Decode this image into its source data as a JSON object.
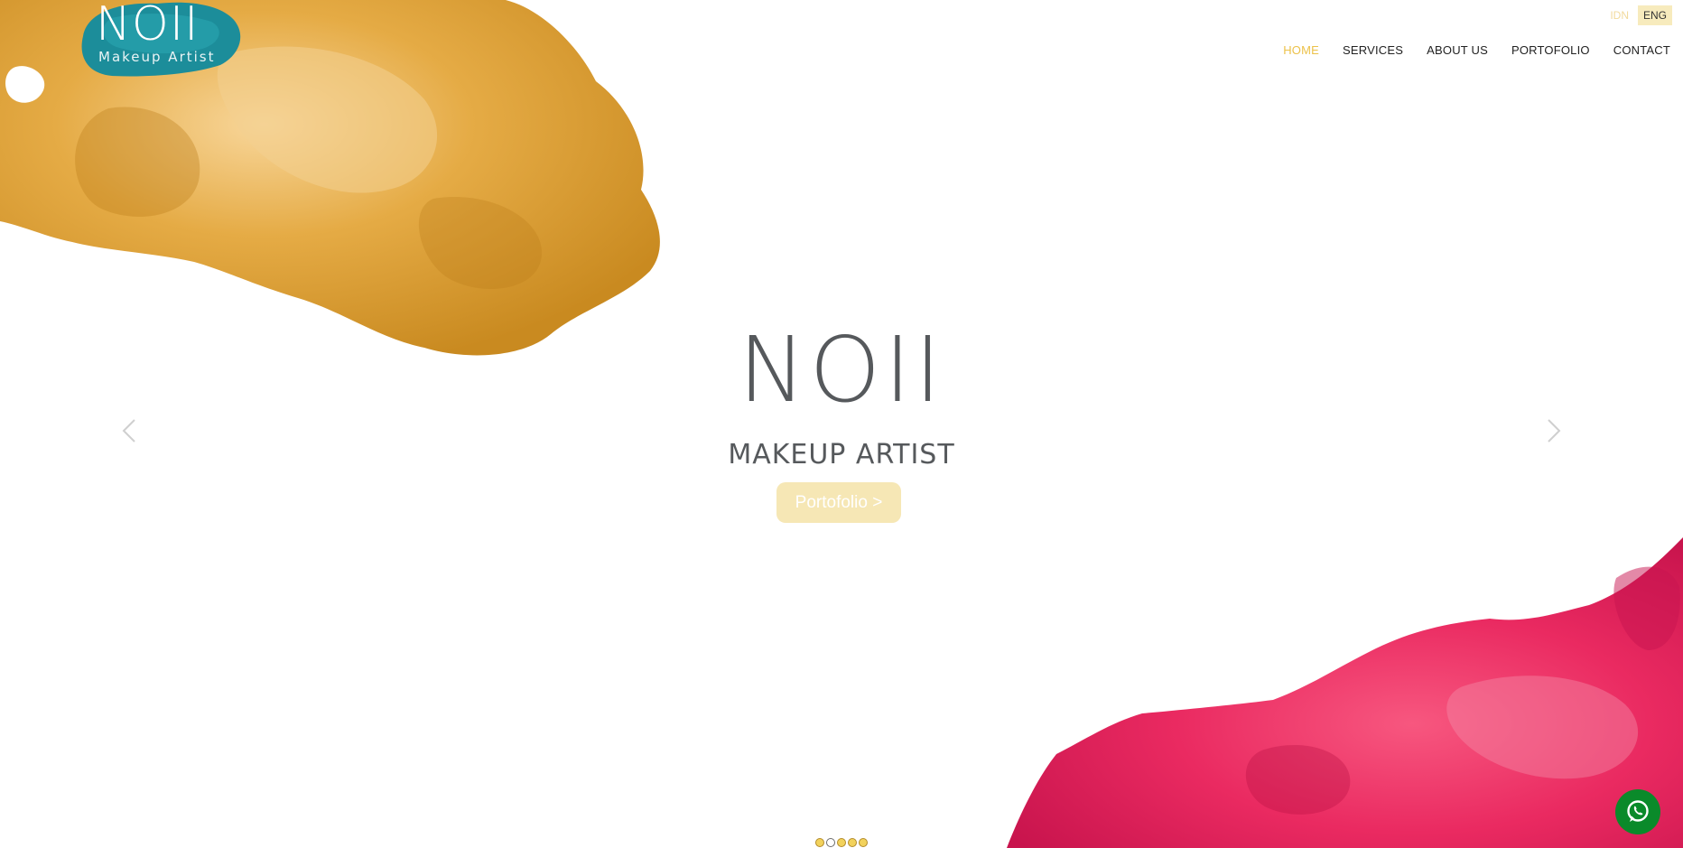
{
  "brand": {
    "logo_title": "NOII",
    "logo_subtitle": "Makeup Artist"
  },
  "language": {
    "options": [
      "IDN",
      "ENG"
    ],
    "selected": "ENG"
  },
  "nav": {
    "items": [
      "HOME",
      "SERVICES",
      "ABOUT US",
      "PORTOFOLIO",
      "CONTACT"
    ],
    "active": "HOME"
  },
  "hero": {
    "title": "NOII",
    "subtitle": "MAKEUP ARTIST",
    "cta_label": "Portofolio >"
  },
  "carousel": {
    "slide_count": 5,
    "active_index": 1,
    "prev_icon": "chevron-left-icon",
    "next_icon": "chevron-right-icon"
  },
  "whatsapp": {
    "icon": "whatsapp-icon"
  },
  "colors": {
    "accent": "#ecc24a",
    "cta_background": "#f6e7b5",
    "gold": "#dca437",
    "pink": "#ea2a61",
    "logo_teal": "#1c8d9a",
    "text_dark": "#56595c",
    "whatsapp": "#0a8a2a"
  }
}
